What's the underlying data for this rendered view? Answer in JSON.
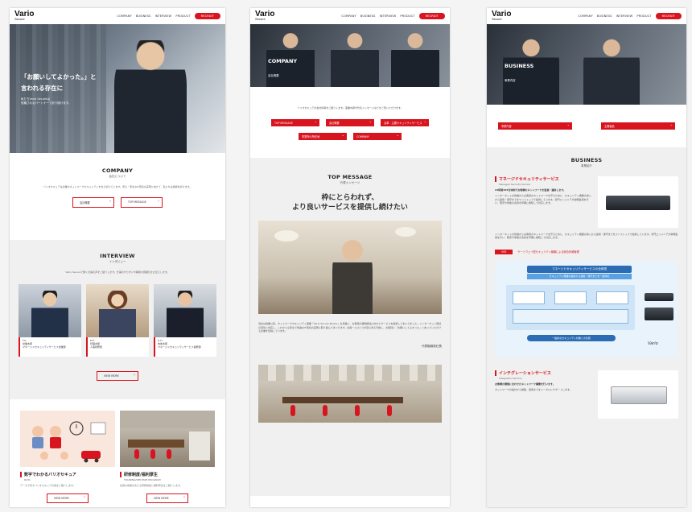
{
  "header": {
    "logo": "Vario",
    "logo_sub": "Secure",
    "nav": [
      "COMPANY",
      "BUSINESS",
      "INTERVIEW",
      "PRODUCT"
    ],
    "recruit": "RECRUIT"
  },
  "top": {
    "hero": {
      "line1": "「お願いしてよかった。」と",
      "line2": "言われる存在に",
      "small1": "私たちVario Secureは",
      "small2": "信頼されるパートナーであり続けます。"
    },
    "company": {
      "title": "COMPANY",
      "sub": "会社について",
      "desc": "バリオセキュアは企業のネットワークセキュリティを支え続けています。安心・安全なIT環境の実現に向けて、私たちは挑戦を続けます。",
      "btn1": "会社概要",
      "btn2": "TOP MESSAGE"
    },
    "interview": {
      "title": "INTERVIEW",
      "sub": "インタビュー",
      "desc": "Vario Secureで働く社員の声をご紹介します。仕事のやりがいや職場の雰囲気をお伝えします。",
      "cards": [
        {
          "name": "T.K.",
          "dept": "営業本部",
          "role": "マネージドセキュリティサービス営業部"
        },
        {
          "name": "M.F.",
          "dept": "管理本部",
          "role": "人事総務部"
        },
        {
          "name": "D.H.",
          "dept": "技術本部",
          "role": "マネージドセキュリティサービス開発部"
        }
      ],
      "viewmore": "VIEW MORE"
    },
    "features": [
      {
        "title": "数字でわかるバリオセキュア",
        "sub": "DATA",
        "desc": "データで見るバリオセキュアの姿をご紹介します。",
        "btn": "VIEW MORE"
      },
      {
        "title": "研修制度/福利厚生",
        "sub": "TRAINING/WELFARE PROGRAM",
        "desc": "社員の成長を支える研修制度と福利厚生をご紹介します。",
        "btn": "VIEW MORE"
      }
    ]
  },
  "company_page": {
    "banner_title": "COMPANY",
    "banner_sub": "会社概要",
    "intro": "バリオセキュアの会社情報をご紹介します。事業内容や代表メッセージなどをご覧いただけます。",
    "links": [
      "TOP MESSAGE",
      "会社概要",
      "沿革・主要セキュリティサービス",
      "事業所の所在地",
      "COMPANY"
    ],
    "msg_title": "TOP MESSAGE",
    "msg_sub": "代表メッセージ",
    "quote1": "枠にとらわれず、",
    "quote2": "より良いサービスを提供し続けたい",
    "body": "当社は創業以来、ネットワークセキュリティ事業「Vario Secure Router」を基盤に、お客様の課題解決に向けたサービスを提供してまいりました。インターネット環境の変化に対応し、これからも安全で快適なIT環境の実現に取り組んでまいります。社員一人ひとりが自ら考え行動し、お客様に「お願いしてよかった」と言っていただける企業を目指しています。",
    "signature": "代表取締役社長"
  },
  "business_page": {
    "banner_title": "BUSINESS",
    "banner_sub": "事業内容",
    "tabs": [
      "事業内容",
      "主要製品"
    ],
    "title": "BUSINESS",
    "sub": "事業紹介",
    "s1_title": "マネージドセキュリティサービス",
    "s1_sub": "Managed Security Service",
    "s1_lead": "24時間365日体制でお客様のネットワークを監視・運用します。",
    "s1_body": "インターネットの脅威からお客様のネットワークを守るために、セキュリティ機器の導入から運用・保守までをワンストップで提供しています。専門エンジニアが常時監視を行い、障害や攻撃の兆候を早期に検知して対応します。",
    "badge": "VSR",
    "s1b": "ゲートウェイ型セキュリティ機器による統合脅威管理",
    "diag_title": "マネージドセキュリティサービスの全体図",
    "diag_sub": "セキュリティ機器の提供から運用・保守までを一括対応",
    "diag_foot": "一般的なセキュリティ対策との比較",
    "brand": "Vario",
    "s2_title": "インテグレーションサービス",
    "s2_sub": "Integration Service",
    "s2_lead": "お客様の環境に合わせたネットワーク構築を行います。",
    "s2_body": "ネットワークの設計から構築、運用までをトータルにサポートします。"
  }
}
